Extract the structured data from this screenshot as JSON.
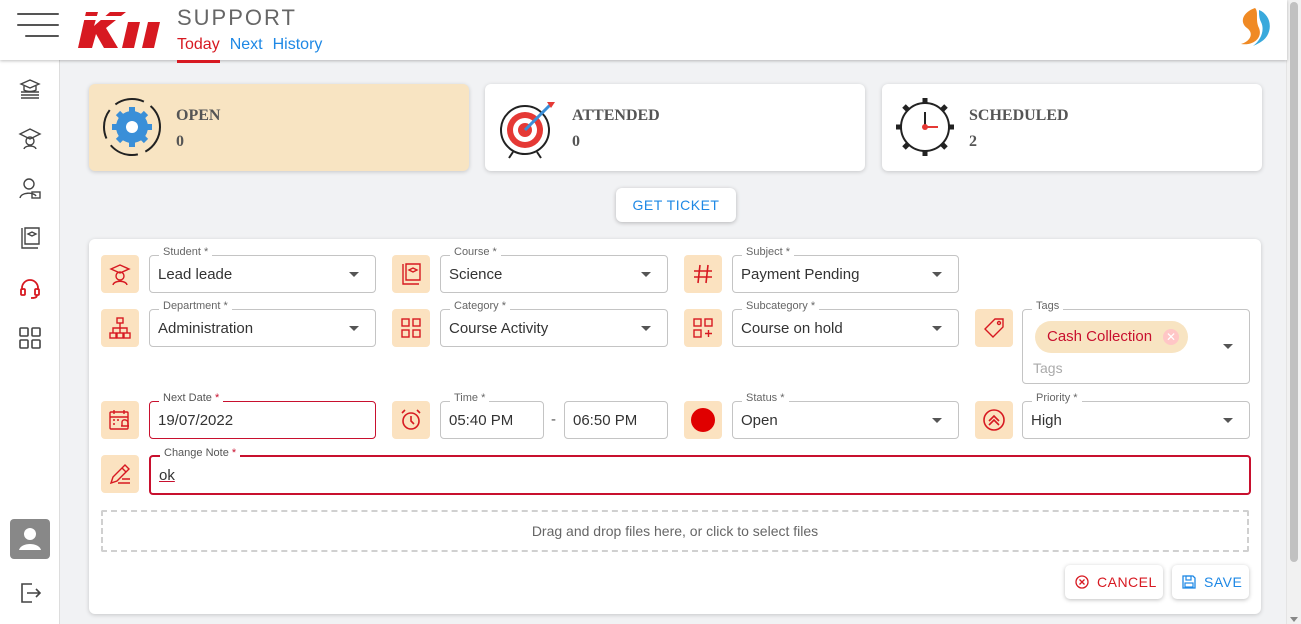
{
  "header": {
    "title": "SUPPORT",
    "logo_text": "KII",
    "tabs": [
      {
        "label": "Today",
        "active": true
      },
      {
        "label": "Next",
        "active": false
      },
      {
        "label": "History",
        "active": false
      }
    ]
  },
  "sidebar": {
    "items": [
      "courses-icon",
      "graduate-icon",
      "user-icon",
      "library-icon",
      "headset-icon",
      "dashboard-icon"
    ],
    "active_item": "headset-icon"
  },
  "stats": [
    {
      "label": "OPEN",
      "value": "0",
      "active": true
    },
    {
      "label": "ATTENDED",
      "value": "0",
      "active": false
    },
    {
      "label": "SCHEDULED",
      "value": "2",
      "active": false
    }
  ],
  "get_ticket_label": "GET TICKET",
  "form": {
    "student": {
      "label": "Student",
      "value": "Lead leade"
    },
    "course": {
      "label": "Course",
      "value": "Science"
    },
    "subject": {
      "label": "Subject",
      "value": "Payment Pending"
    },
    "department": {
      "label": "Department",
      "value": "Administration"
    },
    "category": {
      "label": "Category",
      "value": "Course Activity"
    },
    "subcategory": {
      "label": "Subcategory",
      "value": "Course on hold"
    },
    "tags": {
      "label": "Tags",
      "chip": "Cash Collection",
      "placeholder": "Tags"
    },
    "next_date": {
      "label": "Next Date",
      "value": "19/07/2022"
    },
    "time": {
      "label": "Time",
      "start": "05:40 PM",
      "end": "06:50 PM",
      "separator": "-"
    },
    "status": {
      "label": "Status",
      "value": "Open"
    },
    "priority": {
      "label": "Priority",
      "value": "High"
    },
    "change_note": {
      "label": "Change Note",
      "value": "ok"
    },
    "required_mark": "*",
    "dropzone": "Drag and drop files here, or click to select files",
    "cancel_label": "CANCEL",
    "save_label": "SAVE"
  },
  "colors": {
    "accent": "#d71921",
    "link": "#1e88e5",
    "highlight": "#f8e4c2"
  }
}
